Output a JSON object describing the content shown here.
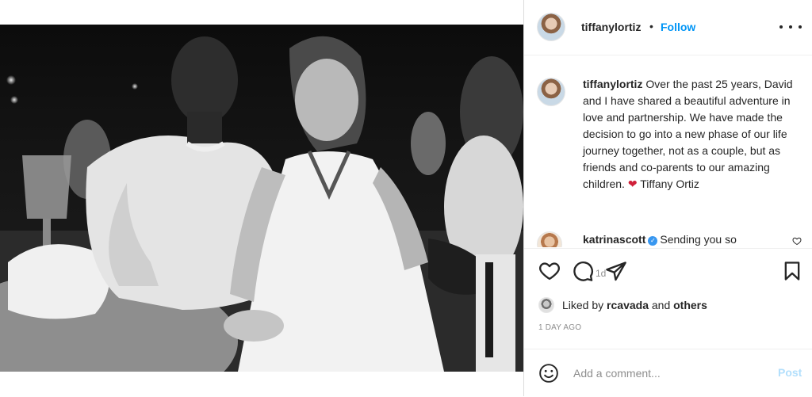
{
  "header": {
    "username": "tiffanylortiz",
    "separator": "•",
    "follow_label": "Follow"
  },
  "photo": {
    "subject": "black-and-white photo of a couple seated at an evening table"
  },
  "caption": {
    "username": "tiffanylortiz",
    "text": "Over the past 25 years, David and I have shared a beautiful adventure in love and partnership. We have made the decision to go into a new phase of our life journey together, not as a couple, but as friends and co-parents to our amazing children.",
    "heart": "❤",
    "signature": "Tiffany Ortiz",
    "time": "1d"
  },
  "comment": {
    "username": "katrinascott",
    "verified_mark": "✓",
    "text": "Sending you so"
  },
  "likes": {
    "prefix": "Liked by",
    "user": "rcavada",
    "conjunction": "and",
    "suffix": "others"
  },
  "timestamp": "1 DAY AGO",
  "add_comment": {
    "placeholder": "Add a comment...",
    "post_label": "Post"
  },
  "icons": {
    "more": "more-options-icon",
    "like": "heart-icon",
    "comment": "comment-icon",
    "share": "paper-plane-icon",
    "save": "bookmark-icon",
    "emoji": "emoji-icon"
  },
  "colors": {
    "accent": "#0095f6",
    "post_disabled": "#b2dffc",
    "heart_emoji": "#d0213a",
    "muted": "#8e8e8e",
    "border": "#dbdbdb"
  }
}
